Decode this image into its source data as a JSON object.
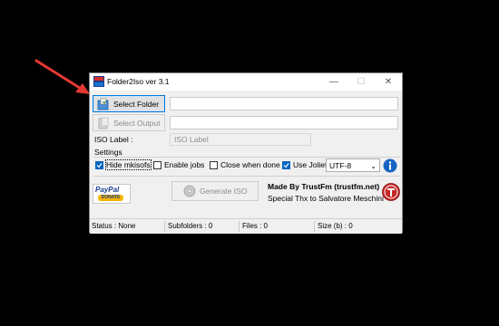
{
  "window": {
    "title": "Folder2Iso ver 3.1"
  },
  "buttons": {
    "select_folder": "Select Folder",
    "select_output": "Select Output",
    "generate_iso": "Generate ISO"
  },
  "iso_label": {
    "label": "ISO Label :",
    "placeholder": "ISO Label"
  },
  "settings": {
    "title": "Settings",
    "options": [
      {
        "label": "Hide mkisofs",
        "checked": true
      },
      {
        "label": "Enable jobs",
        "checked": false
      },
      {
        "label": "Close when done",
        "checked": false
      },
      {
        "label": "Use Joliet",
        "checked": true
      }
    ],
    "encoding": "UTF-8"
  },
  "paypal": {
    "brand": "PayPal",
    "action": "DONATE"
  },
  "credits": {
    "made_by": "Made By TrustFm (trustfm.net)",
    "thanks": "Special Thx to Salvatore Meschini"
  },
  "status": {
    "status": "Status : None",
    "subfolders": "Subfolders : 0",
    "files": "Files : 0",
    "size": "Size (b) : 0"
  },
  "colors": {
    "accent": "#0078d7",
    "annotation": "#e53935",
    "info": "#1565c0",
    "trust_logo": "#c62828"
  }
}
